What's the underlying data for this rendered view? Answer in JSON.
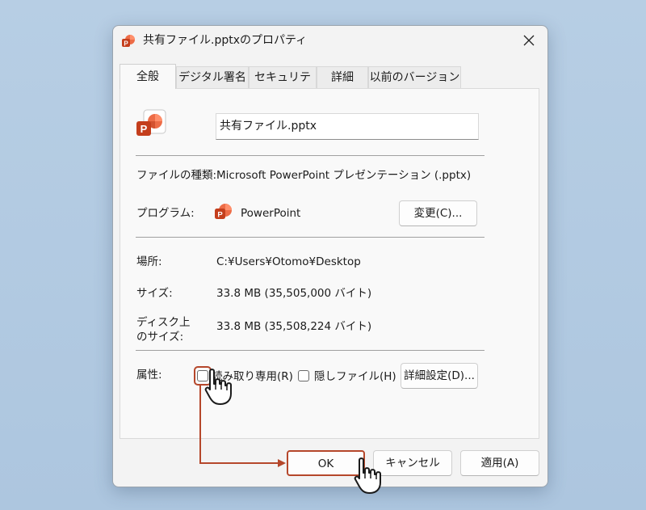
{
  "dialog": {
    "title": "共有ファイル.pptxのプロパティ",
    "tabs": [
      {
        "label": "全般",
        "active": true
      },
      {
        "label": "デジタル署名"
      },
      {
        "label": "セキュリティ"
      },
      {
        "label": "詳細"
      },
      {
        "label": "以前のバージョン"
      }
    ]
  },
  "general": {
    "file_name": "共有ファイル.pptx",
    "file_type_label": "ファイルの種類:",
    "file_type_value": "Microsoft PowerPoint プレゼンテーション (.pptx)",
    "program_label": "プログラム:",
    "program_value": "PowerPoint",
    "change_button": "変更(C)...",
    "location_label": "場所:",
    "location_value": "C:¥Users¥Otomo¥Desktop",
    "size_label": "サイズ:",
    "size_value": "33.8 MB (35,505,000 バイト)",
    "disk_size_label_line1": "ディスク上",
    "disk_size_label_line2": "のサイズ:",
    "disk_size_value": "33.8 MB (35,508,224 バイト)",
    "attributes_label": "属性:",
    "readonly_label": "読み取り専用(R)",
    "hidden_label": "隠しファイル(H)",
    "advanced_button": "詳細設定(D)..."
  },
  "footer": {
    "ok": "OK",
    "cancel": "キャンセル",
    "apply": "適用(A)"
  },
  "colors": {
    "annotation": "#b5472b",
    "powerpoint": "#c43e1c"
  },
  "icons": [
    "powerpoint-icon",
    "close-icon",
    "hand-pointer-icon",
    "arrow-icon"
  ]
}
